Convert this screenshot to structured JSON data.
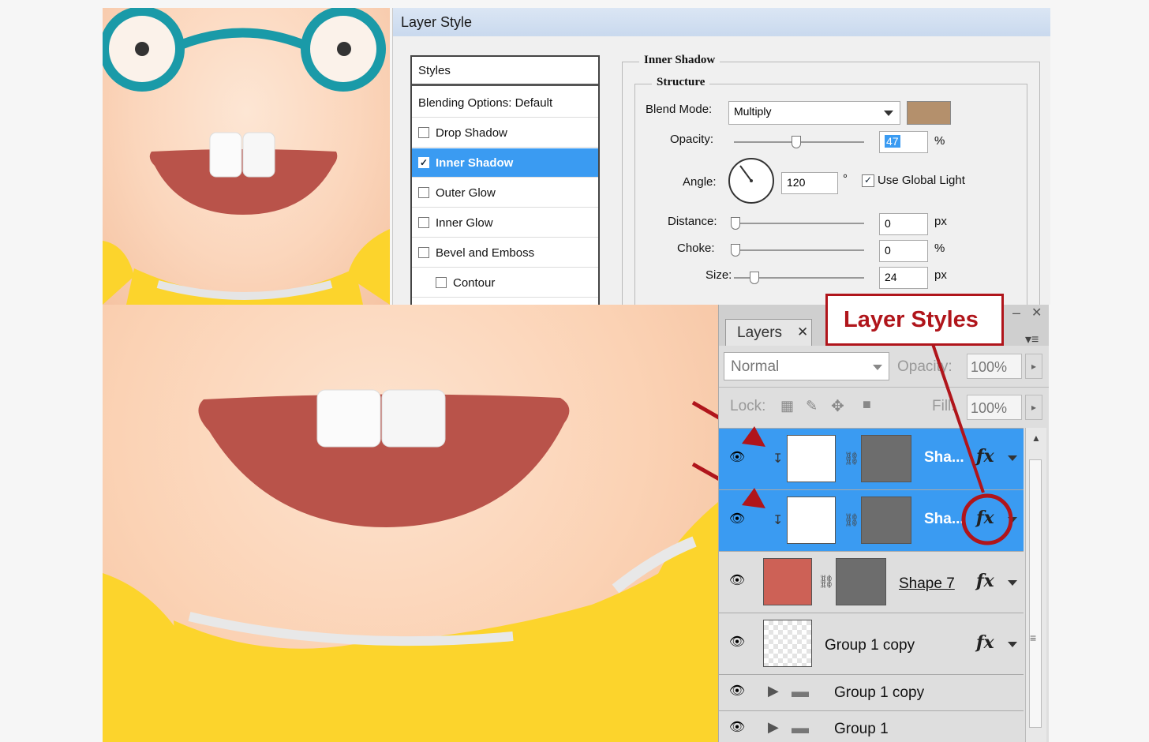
{
  "dialog": {
    "title": "Layer Style",
    "styles_list": {
      "header": "Styles",
      "items": [
        {
          "label": "Blending Options: Default",
          "checkbox": false,
          "checked": false,
          "selected": false
        },
        {
          "label": "Drop Shadow",
          "checkbox": true,
          "checked": false,
          "selected": false
        },
        {
          "label": "Inner Shadow",
          "checkbox": true,
          "checked": true,
          "selected": true
        },
        {
          "label": "Outer Glow",
          "checkbox": true,
          "checked": false,
          "selected": false
        },
        {
          "label": "Inner Glow",
          "checkbox": true,
          "checked": false,
          "selected": false
        },
        {
          "label": "Bevel and Emboss",
          "checkbox": true,
          "checked": false,
          "selected": false
        },
        {
          "label": "Contour",
          "checkbox": true,
          "checked": false,
          "selected": false
        }
      ]
    },
    "section_title": "Inner Shadow",
    "subsection_title": "Structure",
    "blend_mode_label": "Blend Mode:",
    "blend_mode_value": "Multiply",
    "shadow_color": "#b4906c",
    "opacity_label": "Opacity:",
    "opacity_value": "47",
    "opacity_unit": "%",
    "angle_label": "Angle:",
    "angle_value": "120",
    "angle_unit": "°",
    "use_global_light_label": "Use Global Light",
    "use_global_light_checked": true,
    "distance_label": "Distance:",
    "distance_value": "0",
    "distance_unit": "px",
    "choke_label": "Choke:",
    "choke_value": "0",
    "choke_unit": "%",
    "size_label": "Size:",
    "size_value": "24",
    "size_unit": "px"
  },
  "callout": {
    "text": "Layer Styles",
    "color": "#b0151b"
  },
  "layers_panel": {
    "tab_label": "Layers",
    "blend_mode": "Normal",
    "opacity_label": "Opacity:",
    "opacity_value": "100%",
    "lock_label": "Lock:",
    "fill_label": "Fill:",
    "fill_value": "100%",
    "layers": [
      {
        "name": "Sha...",
        "selected": true,
        "fx": "fx",
        "thumb": "white",
        "mask": true
      },
      {
        "name": "Sha...",
        "selected": true,
        "fx": "fx",
        "thumb": "white",
        "mask": true
      },
      {
        "name": "Shape 7",
        "selected": false,
        "fx": "fx",
        "thumb": "red",
        "mask": true
      },
      {
        "name": "Group 1 copy",
        "selected": false,
        "fx": "fx",
        "thumb": "transparent",
        "mask": false
      },
      {
        "name": "Group 1 copy",
        "selected": false,
        "fx": "",
        "thumb": "folder",
        "mask": false
      },
      {
        "name": "Group 1",
        "selected": false,
        "fx": "",
        "thumb": "folder",
        "mask": false
      }
    ]
  },
  "colors": {
    "accent_selection": "#3a9bf2",
    "mouth": "#b9534a",
    "shirt": "#fcd42c",
    "glasses": "#1a9aa8"
  }
}
